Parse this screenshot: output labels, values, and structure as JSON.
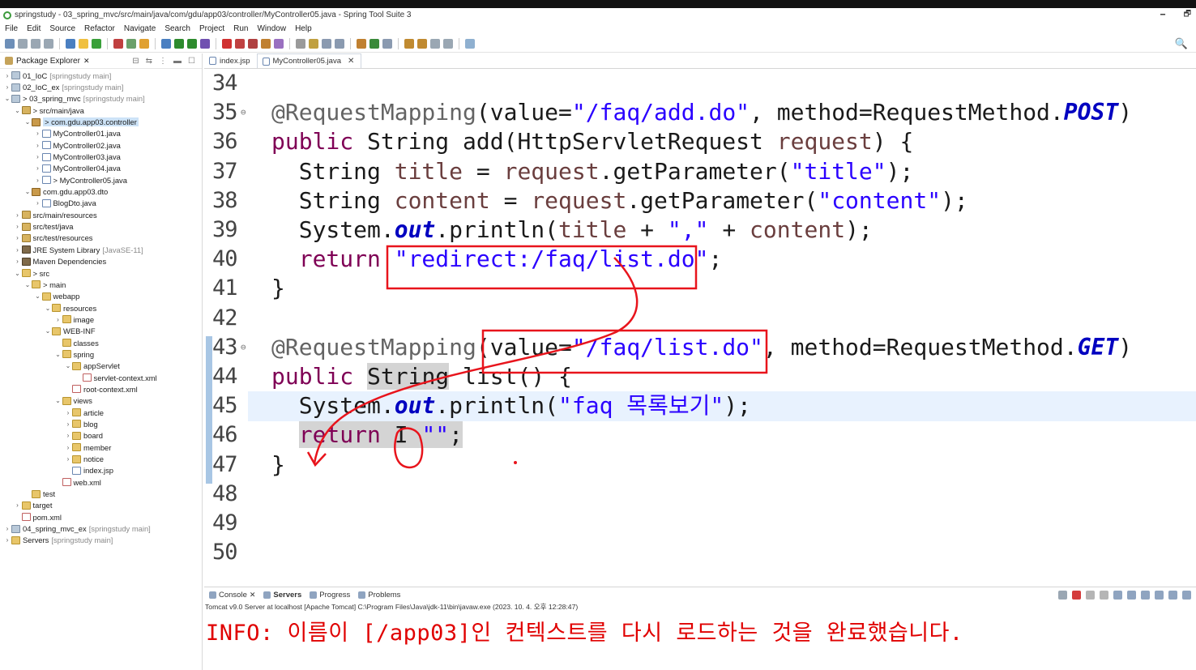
{
  "window": {
    "title": "springstudy - 03_spring_mvc/src/main/java/com/gdu/app03/controller/MyController05.java - Spring Tool Suite 3",
    "minimize": "🗕",
    "restore": "🗗"
  },
  "menu": [
    "File",
    "Edit",
    "Source",
    "Refactor",
    "Navigate",
    "Search",
    "Project",
    "Run",
    "Window",
    "Help"
  ],
  "explorer": {
    "tab_label": "Package Explorer",
    "tree": [
      {
        "depth": 0,
        "arrow": ">",
        "icon": "project",
        "label": "01_IoC",
        "suffix": "[springstudy main]"
      },
      {
        "depth": 0,
        "arrow": ">",
        "icon": "project",
        "label": "02_IoC_ex",
        "suffix": "[springstudy main]"
      },
      {
        "depth": 0,
        "arrow": "v",
        "icon": "project",
        "label": "> 03_spring_mvc",
        "suffix": "[springstudy main]"
      },
      {
        "depth": 1,
        "arrow": "v",
        "icon": "srcfolder",
        "label": "> src/main/java",
        "suffix": ""
      },
      {
        "depth": 2,
        "arrow": "v",
        "icon": "package",
        "label": "> com.gdu.app03.controller",
        "suffix": "",
        "selected": true
      },
      {
        "depth": 3,
        "arrow": ">",
        "icon": "java",
        "label": "MyController01.java",
        "suffix": ""
      },
      {
        "depth": 3,
        "arrow": ">",
        "icon": "java",
        "label": "MyController02.java",
        "suffix": ""
      },
      {
        "depth": 3,
        "arrow": ">",
        "icon": "java",
        "label": "MyController03.java",
        "suffix": ""
      },
      {
        "depth": 3,
        "arrow": ">",
        "icon": "java",
        "label": "MyController04.java",
        "suffix": ""
      },
      {
        "depth": 3,
        "arrow": ">",
        "icon": "java",
        "label": "> MyController05.java",
        "suffix": ""
      },
      {
        "depth": 2,
        "arrow": "v",
        "icon": "package",
        "label": "com.gdu.app03.dto",
        "suffix": ""
      },
      {
        "depth": 3,
        "arrow": ">",
        "icon": "java",
        "label": "BlogDto.java",
        "suffix": ""
      },
      {
        "depth": 1,
        "arrow": ">",
        "icon": "srcfolder",
        "label": "src/main/resources",
        "suffix": ""
      },
      {
        "depth": 1,
        "arrow": ">",
        "icon": "srcfolder",
        "label": "src/test/java",
        "suffix": ""
      },
      {
        "depth": 1,
        "arrow": ">",
        "icon": "srcfolder",
        "label": "src/test/resources",
        "suffix": ""
      },
      {
        "depth": 1,
        "arrow": ">",
        "icon": "lib",
        "label": "JRE System Library",
        "suffix": "[JavaSE-11]"
      },
      {
        "depth": 1,
        "arrow": ">",
        "icon": "lib",
        "label": "Maven Dependencies",
        "suffix": ""
      },
      {
        "depth": 1,
        "arrow": "v",
        "icon": "folder",
        "label": "> src",
        "suffix": ""
      },
      {
        "depth": 2,
        "arrow": "v",
        "icon": "folder",
        "label": "> main",
        "suffix": ""
      },
      {
        "depth": 3,
        "arrow": "v",
        "icon": "folder",
        "label": "webapp",
        "suffix": ""
      },
      {
        "depth": 4,
        "arrow": "v",
        "icon": "folder",
        "label": "resources",
        "suffix": ""
      },
      {
        "depth": 5,
        "arrow": ">",
        "icon": "folder",
        "label": "image",
        "suffix": ""
      },
      {
        "depth": 4,
        "arrow": "v",
        "icon": "folder",
        "label": "WEB-INF",
        "suffix": ""
      },
      {
        "depth": 5,
        "arrow": "",
        "icon": "folder",
        "label": "classes",
        "suffix": ""
      },
      {
        "depth": 5,
        "arrow": "v",
        "icon": "folder",
        "label": "spring",
        "suffix": ""
      },
      {
        "depth": 6,
        "arrow": "v",
        "icon": "folder",
        "label": "appServlet",
        "suffix": ""
      },
      {
        "depth": 7,
        "arrow": "",
        "icon": "xml",
        "label": "servlet-context.xml",
        "suffix": ""
      },
      {
        "depth": 6,
        "arrow": "",
        "icon": "xml",
        "label": "root-context.xml",
        "suffix": ""
      },
      {
        "depth": 5,
        "arrow": "v",
        "icon": "folder",
        "label": "views",
        "suffix": ""
      },
      {
        "depth": 6,
        "arrow": ">",
        "icon": "folder",
        "label": "article",
        "suffix": ""
      },
      {
        "depth": 6,
        "arrow": ">",
        "icon": "folder",
        "label": "blog",
        "suffix": ""
      },
      {
        "depth": 6,
        "arrow": ">",
        "icon": "folder",
        "label": "board",
        "suffix": ""
      },
      {
        "depth": 6,
        "arrow": ">",
        "icon": "folder",
        "label": "member",
        "suffix": ""
      },
      {
        "depth": 6,
        "arrow": ">",
        "icon": "folder",
        "label": "notice",
        "suffix": ""
      },
      {
        "depth": 6,
        "arrow": "",
        "icon": "java",
        "label": "index.jsp",
        "suffix": ""
      },
      {
        "depth": 5,
        "arrow": "",
        "icon": "xml",
        "label": "web.xml",
        "suffix": ""
      },
      {
        "depth": 2,
        "arrow": "",
        "icon": "folder",
        "label": "test",
        "suffix": ""
      },
      {
        "depth": 1,
        "arrow": ">",
        "icon": "folder",
        "label": "target",
        "suffix": ""
      },
      {
        "depth": 1,
        "arrow": "",
        "icon": "xml",
        "label": "pom.xml",
        "suffix": ""
      },
      {
        "depth": 0,
        "arrow": ">",
        "icon": "project",
        "label": "04_spring_mvc_ex",
        "suffix": "[springstudy main]"
      },
      {
        "depth": 0,
        "arrow": ">",
        "icon": "folder",
        "label": "Servers",
        "suffix": "[springstudy main]"
      }
    ]
  },
  "editor": {
    "tabs": [
      {
        "label": "index.jsp",
        "active": false
      },
      {
        "label": "MyController05.java",
        "active": true
      }
    ],
    "close_glyph": "✕",
    "lines": [
      {
        "num": "34",
        "fold": "",
        "code": []
      },
      {
        "num": "35",
        "fold": "⊖",
        "code": [
          [
            "ann",
            "@RequestMapping"
          ],
          [
            "p",
            "(value="
          ],
          [
            "str",
            "\"/faq/add.do\""
          ],
          [
            "p",
            ", method=RequestMethod."
          ],
          [
            "fld",
            "POST"
          ],
          [
            "p",
            ")"
          ]
        ]
      },
      {
        "num": "36",
        "fold": "",
        "code": [
          [
            "kw",
            "public"
          ],
          [
            "p",
            " String add(HttpServletRequest "
          ],
          [
            "var",
            "request"
          ],
          [
            "p",
            ") {"
          ]
        ]
      },
      {
        "num": "37",
        "fold": "",
        "code": [
          [
            "p",
            "  String "
          ],
          [
            "var",
            "title"
          ],
          [
            "p",
            " = "
          ],
          [
            "var",
            "request"
          ],
          [
            "p",
            ".getParameter("
          ],
          [
            "str",
            "\"title\""
          ],
          [
            "p",
            ");"
          ]
        ]
      },
      {
        "num": "38",
        "fold": "",
        "code": [
          [
            "p",
            "  String "
          ],
          [
            "var",
            "content"
          ],
          [
            "p",
            " = "
          ],
          [
            "var",
            "request"
          ],
          [
            "p",
            ".getParameter("
          ],
          [
            "str",
            "\"content\""
          ],
          [
            "p",
            ");"
          ]
        ]
      },
      {
        "num": "39",
        "fold": "",
        "code": [
          [
            "p",
            "  System."
          ],
          [
            "fld",
            "out"
          ],
          [
            "p",
            ".println("
          ],
          [
            "var",
            "title"
          ],
          [
            "p",
            " + "
          ],
          [
            "str",
            "\",\""
          ],
          [
            "p",
            " + "
          ],
          [
            "var",
            "content"
          ],
          [
            "p",
            ");"
          ]
        ]
      },
      {
        "num": "40",
        "fold": "",
        "code": [
          [
            "kw",
            "  return"
          ],
          [
            "p",
            " "
          ],
          [
            "str",
            "\"redirect:/faq/list.do\""
          ],
          [
            "p",
            ";"
          ]
        ]
      },
      {
        "num": "41",
        "fold": "",
        "code": [
          [
            "p",
            "}"
          ]
        ]
      },
      {
        "num": "42",
        "fold": "",
        "code": []
      },
      {
        "num": "43",
        "fold": "⊖",
        "code": [
          [
            "ann",
            "@RequestMapping"
          ],
          [
            "p",
            "(value="
          ],
          [
            "str",
            "\"/faq/list.do\""
          ],
          [
            "p",
            ", method=RequestMethod."
          ],
          [
            "fld",
            "GET"
          ],
          [
            "p",
            ")"
          ]
        ]
      },
      {
        "num": "44",
        "fold": "",
        "code": [
          [
            "kw",
            "public"
          ],
          [
            "p",
            " "
          ],
          [
            "hl",
            "String"
          ],
          [
            "p",
            " list() {"
          ]
        ]
      },
      {
        "num": "45",
        "fold": "",
        "current": true,
        "code": [
          [
            "p",
            "  System."
          ],
          [
            "fld",
            "out"
          ],
          [
            "p",
            ".println("
          ],
          [
            "str",
            "\"faq 목록보기\""
          ],
          [
            "p",
            ");"
          ]
        ]
      },
      {
        "num": "46",
        "fold": "",
        "code": [
          [
            "p",
            "  "
          ],
          [
            "hlkw",
            "return"
          ],
          [
            "hl",
            " I "
          ],
          [
            "hlstr",
            "\"\""
          ],
          [
            "hl",
            ";"
          ]
        ]
      },
      {
        "num": "47",
        "fold": "",
        "code": [
          [
            "p",
            "}"
          ]
        ]
      },
      {
        "num": "48",
        "fold": "",
        "code": []
      },
      {
        "num": "49",
        "fold": "",
        "code": []
      },
      {
        "num": "50",
        "fold": "",
        "code": []
      }
    ]
  },
  "console": {
    "tabs": [
      {
        "label": "Console",
        "bold": false
      },
      {
        "label": "Servers",
        "bold": true
      },
      {
        "label": "Progress",
        "bold": false
      },
      {
        "label": "Problems",
        "bold": false
      }
    ],
    "description": "Tomcat v9.0 Server at localhost [Apache Tomcat] C:\\Program Files\\Java\\jdk-11\\bin\\javaw.exe  (2023. 10. 4. 오후 12:28:47)",
    "output": "INFO: 이름이 [/app03]인 컨텍스트를 다시 로드하는 것을 완료했습니다."
  },
  "colors": {
    "keyword": "#7f0055",
    "string": "#2a00ff",
    "annotation": "#646464",
    "field": "#0000c0",
    "variable": "#6a3e3e",
    "console_output": "#e00000",
    "annotation_ink": "#e8141c"
  },
  "icons": {
    "search": "🔍"
  }
}
